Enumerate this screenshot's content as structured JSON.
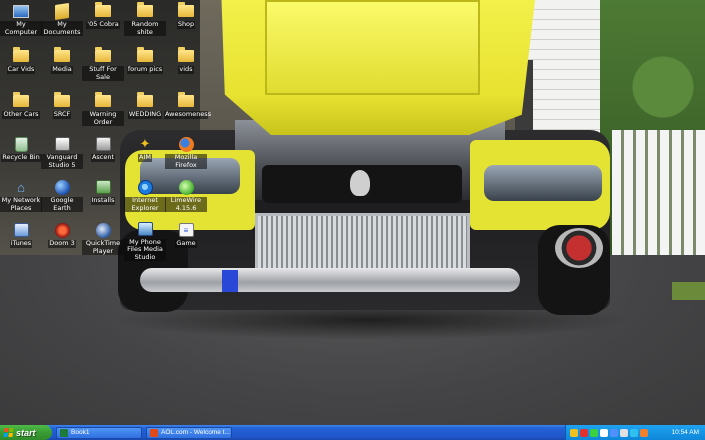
{
  "desktop": {
    "icons": [
      {
        "label": "My Computer",
        "icon": "computer-icon"
      },
      {
        "label": "My Documents",
        "icon": "documents-folder-icon"
      },
      {
        "label": "Recycle Bin",
        "icon": "recycle-bin-icon"
      },
      {
        "label": "My Network Places",
        "icon": "network-places-icon"
      },
      {
        "label": "iTunes",
        "icon": "itunes-icon"
      },
      {
        "label": "'05 Cobra",
        "icon": "folder-icon"
      },
      {
        "label": "Media",
        "icon": "folder-icon"
      },
      {
        "label": "SRCF",
        "icon": "folder-icon"
      },
      {
        "label": "Vanguard Studio 5",
        "icon": "vanguard-icon"
      },
      {
        "label": "Google Earth",
        "icon": "google-earth-icon"
      },
      {
        "label": "Doom 3",
        "icon": "doom3-icon"
      },
      {
        "label": "Random shite",
        "icon": "folder-icon"
      },
      {
        "label": "Stuff For Sale",
        "icon": "folder-icon"
      },
      {
        "label": "Warning Order",
        "icon": "folder-icon"
      },
      {
        "label": "Ascent",
        "icon": "ascent-icon"
      },
      {
        "label": "Installs",
        "icon": "installer-icon"
      },
      {
        "label": "QuickTime Player",
        "icon": "quicktime-icon"
      },
      {
        "label": "Shop",
        "icon": "folder-icon"
      },
      {
        "label": "forum pics",
        "icon": "folder-icon"
      },
      {
        "label": "WEDDING",
        "icon": "folder-icon"
      },
      {
        "label": "AIM",
        "icon": "aim-icon"
      },
      {
        "label": "Internet Explorer",
        "icon": "internet-explorer-icon"
      },
      {
        "label": "My Phone Files Media Studio",
        "icon": "phone-files-icon"
      },
      {
        "label": "Car Vids",
        "icon": "folder-icon"
      },
      {
        "label": "vids",
        "icon": "folder-icon"
      },
      {
        "label": "Awesomeness",
        "icon": "folder-icon"
      },
      {
        "label": "Mozilla Firefox",
        "icon": "firefox-icon"
      },
      {
        "label": "LimeWire 4.15.6",
        "icon": "limewire-icon"
      },
      {
        "label": "Other Cars",
        "icon": "folder-icon"
      },
      {
        "label": "Game",
        "icon": "game-icon"
      }
    ],
    "glyphs": {
      "aim": "✦",
      "network": "⌂",
      "document": "≡"
    }
  },
  "taskbar": {
    "start_label": "start",
    "tasks": [
      {
        "label": "Book1",
        "icon": "excel-icon",
        "color": "#1e7a3c"
      },
      {
        "label": "AOL.com - Welcome t...",
        "icon": "aol-browser-icon",
        "color": "#e04a1a"
      }
    ],
    "tray_icon_colors": [
      "#f0c020",
      "#e23030",
      "#3ad040",
      "#ffffff",
      "#5090ff",
      "#e0e0e0",
      "#30c0f0",
      "#f08030",
      "#ffffff"
    ],
    "clock": "10:54 AM"
  },
  "colors": {
    "taskbar_blue": "#2463d6",
    "start_green": "#3a9c34",
    "tray_blue": "#0f86d9",
    "car_yellow": "#e4e232"
  }
}
